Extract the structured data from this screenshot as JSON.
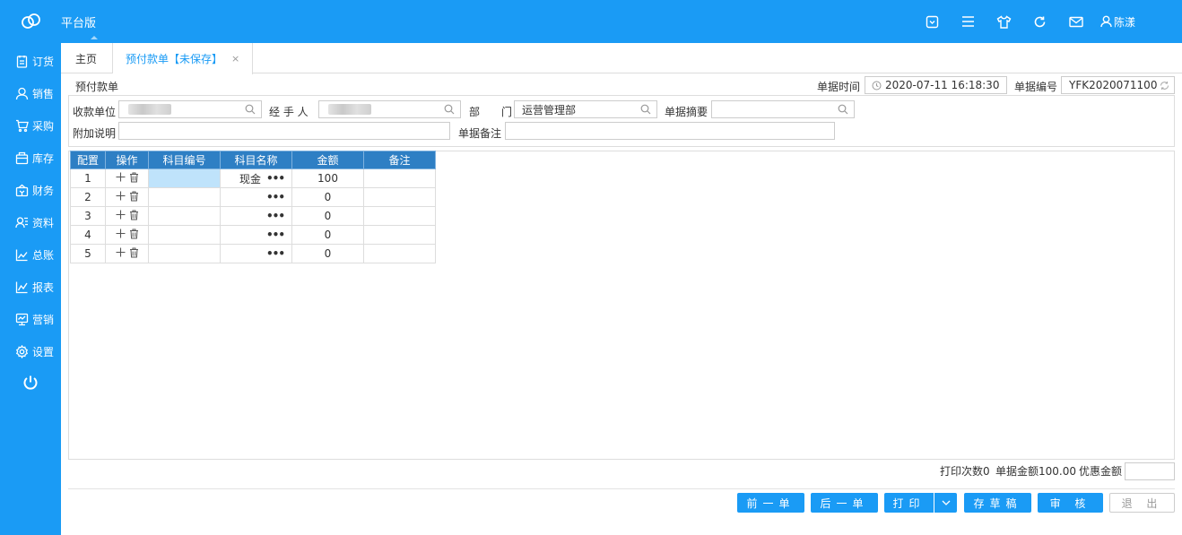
{
  "topbar": {
    "brand": "平台版",
    "user": "陈漾",
    "icons": [
      "collapse-icon",
      "menu-icon",
      "shirt-icon",
      "refresh-icon",
      "mail-icon",
      "user-icon"
    ]
  },
  "sidebar": {
    "items": [
      {
        "label": "订货",
        "icon": "order-icon"
      },
      {
        "label": "销售",
        "icon": "sales-icon"
      },
      {
        "label": "采购",
        "icon": "cart-icon"
      },
      {
        "label": "库存",
        "icon": "inventory-icon"
      },
      {
        "label": "财务",
        "icon": "finance-icon"
      },
      {
        "label": "资料",
        "icon": "contacts-icon"
      },
      {
        "label": "总账",
        "icon": "ledger-icon"
      },
      {
        "label": "报表",
        "icon": "report-icon"
      },
      {
        "label": "营销",
        "icon": "marketing-icon"
      },
      {
        "label": "设置",
        "icon": "gear-icon"
      }
    ]
  },
  "tabs": {
    "home": "主页",
    "active": "预付款单【未保存】",
    "close": "×"
  },
  "header": {
    "doc_title": "预付款单",
    "time_label": "单据时间",
    "time_value": "2020-07-11 16:18:30",
    "number_label": "单据编号",
    "number_value": "YFK2020071100"
  },
  "form": {
    "payee_label": "收款单位",
    "handler_label": "经 手 人",
    "dept_label": "部　　门",
    "dept_value": "运营管理部",
    "summary_label": "单据摘要",
    "extra_label": "附加说明",
    "remark_label": "单据备注"
  },
  "grid": {
    "headers": [
      "配置",
      "操作",
      "科目编号",
      "科目名称",
      "金额",
      "备注"
    ],
    "rows": [
      {
        "idx": "1",
        "code": "",
        "name": "现金",
        "amount": "100",
        "note": ""
      },
      {
        "idx": "2",
        "code": "",
        "name": "",
        "amount": "0",
        "note": ""
      },
      {
        "idx": "3",
        "code": "",
        "name": "",
        "amount": "0",
        "note": ""
      },
      {
        "idx": "4",
        "code": "",
        "name": "",
        "amount": "0",
        "note": ""
      },
      {
        "idx": "5",
        "code": "",
        "name": "",
        "amount": "0",
        "note": ""
      }
    ],
    "dots": "•••"
  },
  "footer": {
    "print_count": "打印次数0",
    "total_amount": "单据金额100.00",
    "discount_label": "优惠金额"
  },
  "buttons": {
    "prev": "前一单",
    "next": "后一单",
    "print": "打印",
    "draft": "存草稿",
    "audit": "审 核",
    "exit": "退 出"
  }
}
